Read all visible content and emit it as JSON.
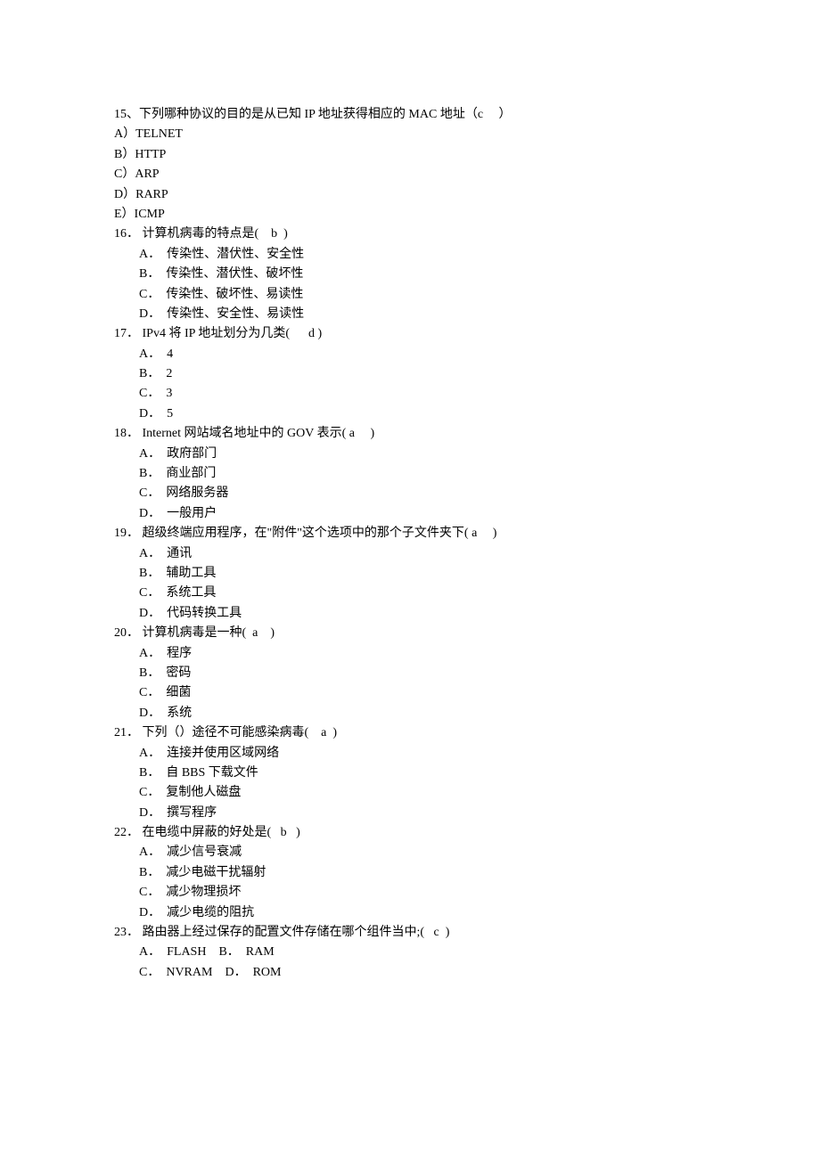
{
  "questions": [
    {
      "num": "15、",
      "stem": "下列哪种协议的目的是从已知 IP 地址获得相应的 MAC 地址（c     ）",
      "options": [
        "A）TELNET",
        "B）HTTP",
        "C）ARP",
        "D）RARP",
        "E）ICMP"
      ],
      "opt_indent": false
    },
    {
      "num": "16．",
      "stem": " 计算机病毒的特点是(    b  )",
      "options": [
        "A．  传染性、潜伏性、安全性",
        "B．  传染性、潜伏性、破坏性",
        "C．  传染性、破坏性、易读性",
        "D．  传染性、安全性、易读性"
      ],
      "opt_indent": true
    },
    {
      "num": "17．",
      "stem": " IPv4 将 IP 地址划分为几类(      d )",
      "options": [
        "A．  4",
        "B．  2",
        "C．  3",
        "D．  5"
      ],
      "opt_indent": true
    },
    {
      "num": "18．",
      "stem": " Internet 网站域名地址中的 GOV 表示( a     )",
      "options": [
        "A．  政府部门",
        "B．  商业部门",
        "C．  网络服务器",
        "D．  一般用户"
      ],
      "opt_indent": true
    },
    {
      "num": "19．",
      "stem": " 超级终端应用程序，在\"附件\"这个选项中的那个子文件夹下( a     )",
      "options": [
        "A．  通讯",
        "B．  辅助工具",
        "C．  系统工具",
        "D．  代码转换工具"
      ],
      "opt_indent": true
    },
    {
      "num": "20．",
      "stem": " 计算机病毒是一种(  a    )",
      "options": [
        "A．  程序",
        "B．  密码",
        "C．  细菌",
        "D．  系统"
      ],
      "opt_indent": true
    },
    {
      "num": "21．",
      "stem": " 下列（）途径不可能感染病毒(    a  )",
      "options": [
        "A．  连接并使用区域网络",
        "B．  自 BBS 下载文件",
        "C．  复制他人磁盘",
        "D．  撰写程序"
      ],
      "opt_indent": true
    },
    {
      "num": "22．",
      "stem": " 在电缆中屏蔽的好处是(   b   )",
      "options": [
        "A．  减少信号衰减",
        "B．  减少电磁干扰辐射",
        "C．  减少物理损坏",
        "D．  减少电缆的阻抗"
      ],
      "opt_indent": true
    },
    {
      "num": "23．",
      "stem": " 路由器上经过保存的配置文件存储在哪个组件当中;(   c  )",
      "options_rows": [
        [
          "A．  FLASH",
          "B．  RAM"
        ],
        [
          "C．  NVRAM",
          "D．  ROM"
        ]
      ],
      "opt_indent": true
    }
  ]
}
